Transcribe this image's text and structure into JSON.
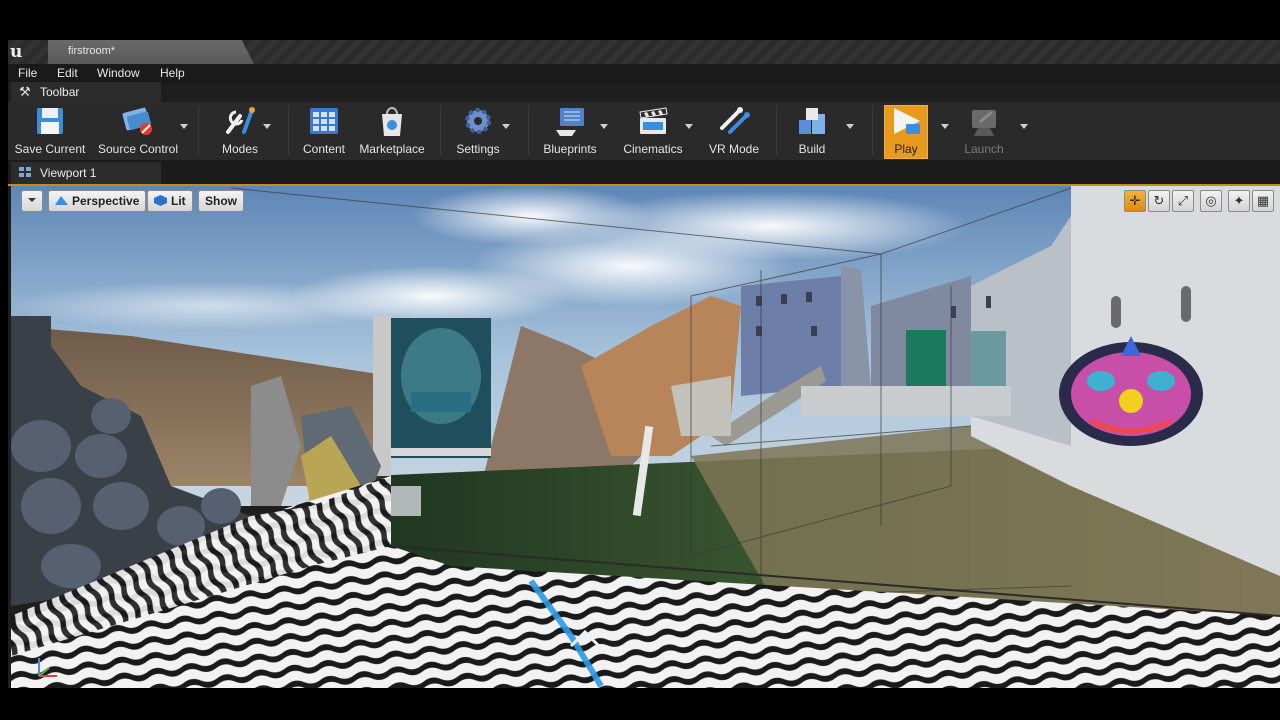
{
  "window": {
    "tab_title": "firstroom*"
  },
  "menu": [
    "File",
    "Edit",
    "Window",
    "Help"
  ],
  "toolbar_tab": {
    "label": "Toolbar"
  },
  "toolbar": {
    "save_current": "Save Current",
    "source_control": "Source Control",
    "modes": "Modes",
    "content": "Content",
    "marketplace": "Marketplace",
    "settings": "Settings",
    "blueprints": "Blueprints",
    "cinematics": "Cinematics",
    "vr_mode": "VR Mode",
    "build": "Build",
    "play": "Play",
    "launch": "Launch"
  },
  "viewport_tab": {
    "label": "Viewport 1"
  },
  "viewport": {
    "perspective": "Perspective",
    "lit": "Lit",
    "show": "Show"
  },
  "colors": {
    "accent": "#e89a1c",
    "play_highlight": "#e89a1c",
    "background": "#1e1e1e"
  }
}
